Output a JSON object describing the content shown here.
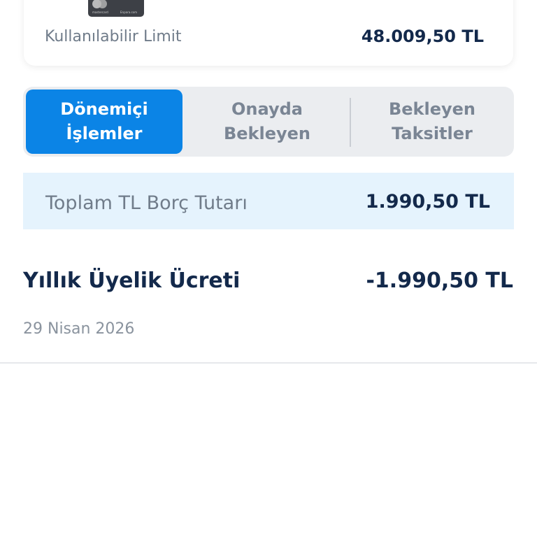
{
  "card_summary": {
    "card_brand_text": "mastercard",
    "card_bank_text": "Enpara.com",
    "limit_label": "Kullanılabilir Limit",
    "limit_value": "48.009,50 TL"
  },
  "tabs": [
    {
      "line1": "Dönemiçi",
      "line2": "İşlemler",
      "active": true
    },
    {
      "line1": "Onayda",
      "line2": "Bekleyen",
      "active": false
    },
    {
      "line1": "Bekleyen",
      "line2": "Taksitler",
      "active": false
    }
  ],
  "total": {
    "label": "Toplam TL Borç Tutarı",
    "value": "1.990,50 TL"
  },
  "transactions": [
    {
      "title": "Yıllık Üyelik Ücreti",
      "amount": "-1.990,50 TL",
      "date": "29 Nisan 2026"
    }
  ],
  "colors": {
    "accent": "#0b84e6",
    "text_primary": "#13294b",
    "text_secondary": "#707c8a",
    "band_background": "#e5f3fd"
  }
}
